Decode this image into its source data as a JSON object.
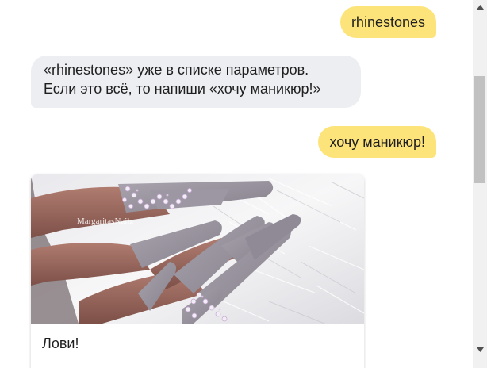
{
  "messages": [
    {
      "sender": "user",
      "text": "rhinestones"
    },
    {
      "sender": "bot",
      "lines": [
        "«rhinestones» уже в списке параметров.",
        "Если это всё, то напиши «хочу маникюр!»"
      ]
    },
    {
      "sender": "user",
      "text": "хочу маникюр!"
    }
  ],
  "card": {
    "image_description": "nail-art-photo",
    "watermark": "MargaritasNailz",
    "caption": "Лови!"
  },
  "colors": {
    "user_bubble": "#fde47a",
    "bot_bubble": "#eceef2",
    "text": "#1f1f1f",
    "scrollbar_track": "#f1f1f1",
    "scrollbar_thumb": "#c1c1c1"
  },
  "icons": {
    "scroll_up": "arrow-up-icon",
    "scroll_down": "arrow-down-icon"
  }
}
